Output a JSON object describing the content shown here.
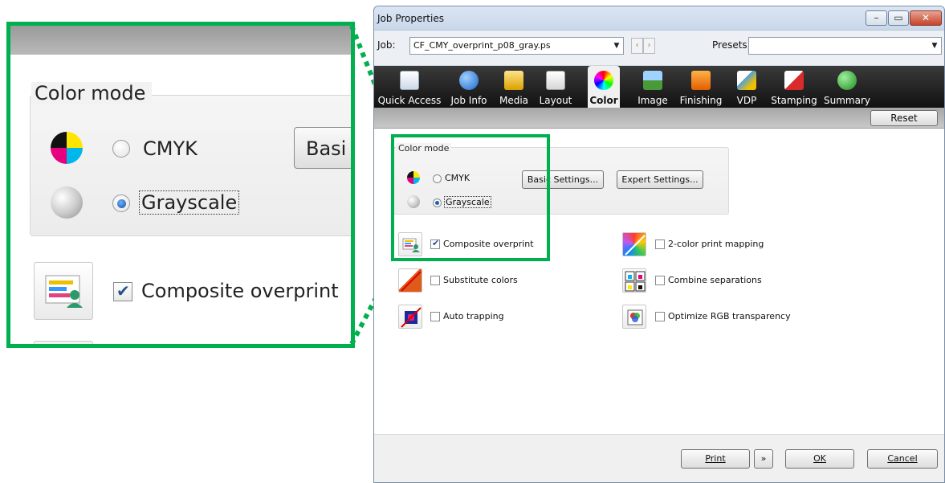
{
  "zoom": {
    "group_label": "Color mode",
    "cmyk_label": "CMYK",
    "grayscale_label": "Grayscale",
    "basic_button_partial": "Basi",
    "composite_label": "Composite overprint"
  },
  "window": {
    "title": "Job Properties",
    "caption_buttons": {
      "minimize": "–",
      "maximize": "▭",
      "close": "✕"
    }
  },
  "jobrow": {
    "job_label": "Job:",
    "job_value": "CF_CMY_overprint_p08_gray.ps",
    "presets_label": "Presets:",
    "presets_value": ""
  },
  "tabs": [
    {
      "label": "Quick Access",
      "icon": "quick-access-icon",
      "active": false
    },
    {
      "label": "Job Info",
      "icon": "info-icon",
      "active": false
    },
    {
      "label": "Media",
      "icon": "media-icon",
      "active": false
    },
    {
      "label": "Layout",
      "icon": "layout-icon",
      "active": false
    },
    {
      "label": "Color",
      "icon": "color-wheel-icon",
      "active": true
    },
    {
      "label": "Image",
      "icon": "image-icon",
      "active": false
    },
    {
      "label": "Finishing",
      "icon": "finishing-icon",
      "active": false
    },
    {
      "label": "VDP",
      "icon": "vdp-icon",
      "active": false
    },
    {
      "label": "Stamping",
      "icon": "stamping-icon",
      "active": false
    },
    {
      "label": "Summary",
      "icon": "checkmark-icon",
      "active": false
    }
  ],
  "subbar": {
    "reset_label": "Reset"
  },
  "color_mode": {
    "group_label": "Color mode",
    "cmyk_label": "CMYK",
    "grayscale_label": "Grayscale",
    "selected": "Grayscale",
    "basic_settings_label": "Basic Settings...",
    "expert_settings_label": "Expert Settings..."
  },
  "options": {
    "composite_overprint": {
      "label": "Composite overprint",
      "checked": true
    },
    "two_color_mapping": {
      "label": "2-color print mapping",
      "checked": false
    },
    "substitute_colors": {
      "label": "Substitute colors",
      "checked": false
    },
    "combine_separations": {
      "label": "Combine separations",
      "checked": false
    },
    "auto_trapping": {
      "label": "Auto trapping",
      "checked": false
    },
    "optimize_rgb": {
      "label": "Optimize RGB transparency",
      "checked": false
    }
  },
  "footer": {
    "print_label": "Print",
    "print_menu_glyph": "»",
    "ok_label": "OK",
    "cancel_label": "Cancel"
  },
  "colors": {
    "highlight": "#00b04f",
    "accent": "#1d5fb8"
  }
}
